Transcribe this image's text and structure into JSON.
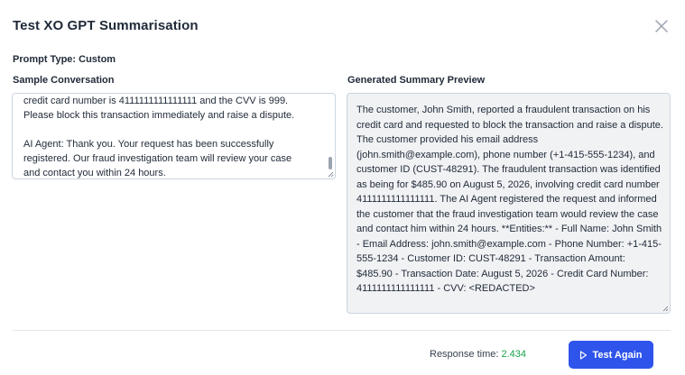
{
  "dialog": {
    "title": "Test XO GPT Summarisation"
  },
  "prompt_type": {
    "label": "Prompt Type:",
    "value": "Custom"
  },
  "sample_conversation": {
    "label": "Sample Conversation",
    "text": "credit card number is 4111111111111111 and the CVV is 999.\nPlease block this transaction immediately and raise a dispute.\n\nAI Agent: Thank you. Your request has been successfully\nregistered. Our fraud investigation team will review your case\nand contact you within 24 hours."
  },
  "summary_preview": {
    "label": "Generated Summary Preview",
    "text": "The customer, John Smith, reported a fraudulent transaction on his credit card and requested to block the transaction and raise a dispute. The customer provided his email address (john.smith@example.com), phone number (+1-415-555-1234), and customer ID (CUST-48291). The fraudulent transaction was identified as being for $485.90 on August 5, 2026, involving credit card number 4111111111111111. The AI Agent registered the request and informed the customer that the fraud investigation team would review the case and contact him within 24 hours. **Entities:** - Full Name: John Smith - Email Address: john.smith@example.com - Phone Number: +1-415-555-1234 - Customer ID: CUST-48291 - Transaction Amount: $485.90 - Transaction Date: August 5, 2026 - Credit Card Number: 4111111111111111 - CVV: <REDACTED>"
  },
  "footer": {
    "response_time_label": "Response time:",
    "response_time_value": "2.434",
    "test_again_label": "Test Again"
  },
  "icons": {
    "close": "close-icon",
    "play": "play-icon",
    "resize": "resize-grip-icon"
  },
  "colors": {
    "primary": "#2f54eb",
    "success": "#16a34a",
    "summary_bg": "#f1f2f4"
  }
}
